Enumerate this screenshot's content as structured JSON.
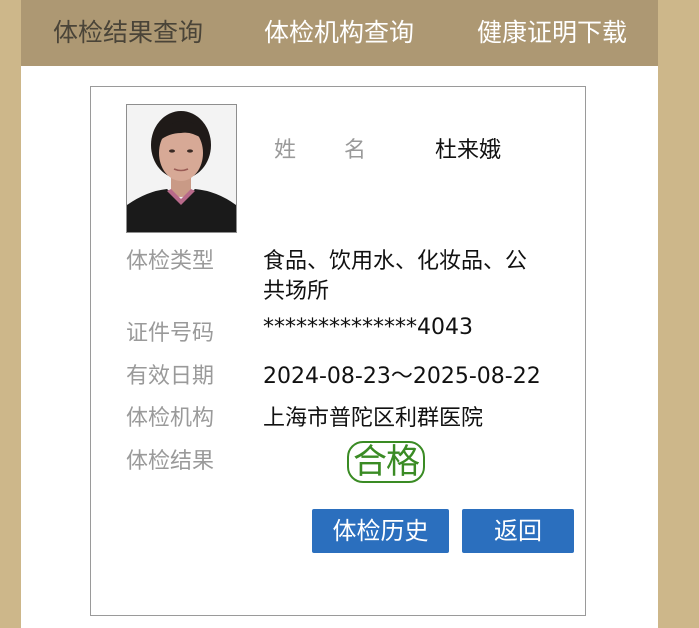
{
  "nav": {
    "items": [
      {
        "label": "体检结果查询",
        "active": true
      },
      {
        "label": "体检机构查询",
        "active": false
      },
      {
        "label": "健康证明下载",
        "active": false
      }
    ]
  },
  "colors": {
    "page_bg": "#cdb78a",
    "nav_bg": "#ad9873",
    "button_bg": "#2b6fbe",
    "result_green": "#3a8b24",
    "label_gray": "#9a9a9a"
  },
  "profile": {
    "name_label_1": "姓",
    "name_label_2": "名",
    "name": "杜来娥"
  },
  "fields": {
    "type_label": "体检类型",
    "type_value_line1": "食品、饮用水、化妆品、公",
    "type_value_line2": "共场所",
    "id_label": "证件号码",
    "id_value": "**************4043",
    "valid_label": "有效日期",
    "valid_value": "2024-08-23～2025-08-22",
    "org_label": "体检机构",
    "org_value": "上海市普陀区利群医院",
    "result_label": "体检结果",
    "result_value": "合格"
  },
  "buttons": {
    "history": "体检历史",
    "back": "返回"
  }
}
